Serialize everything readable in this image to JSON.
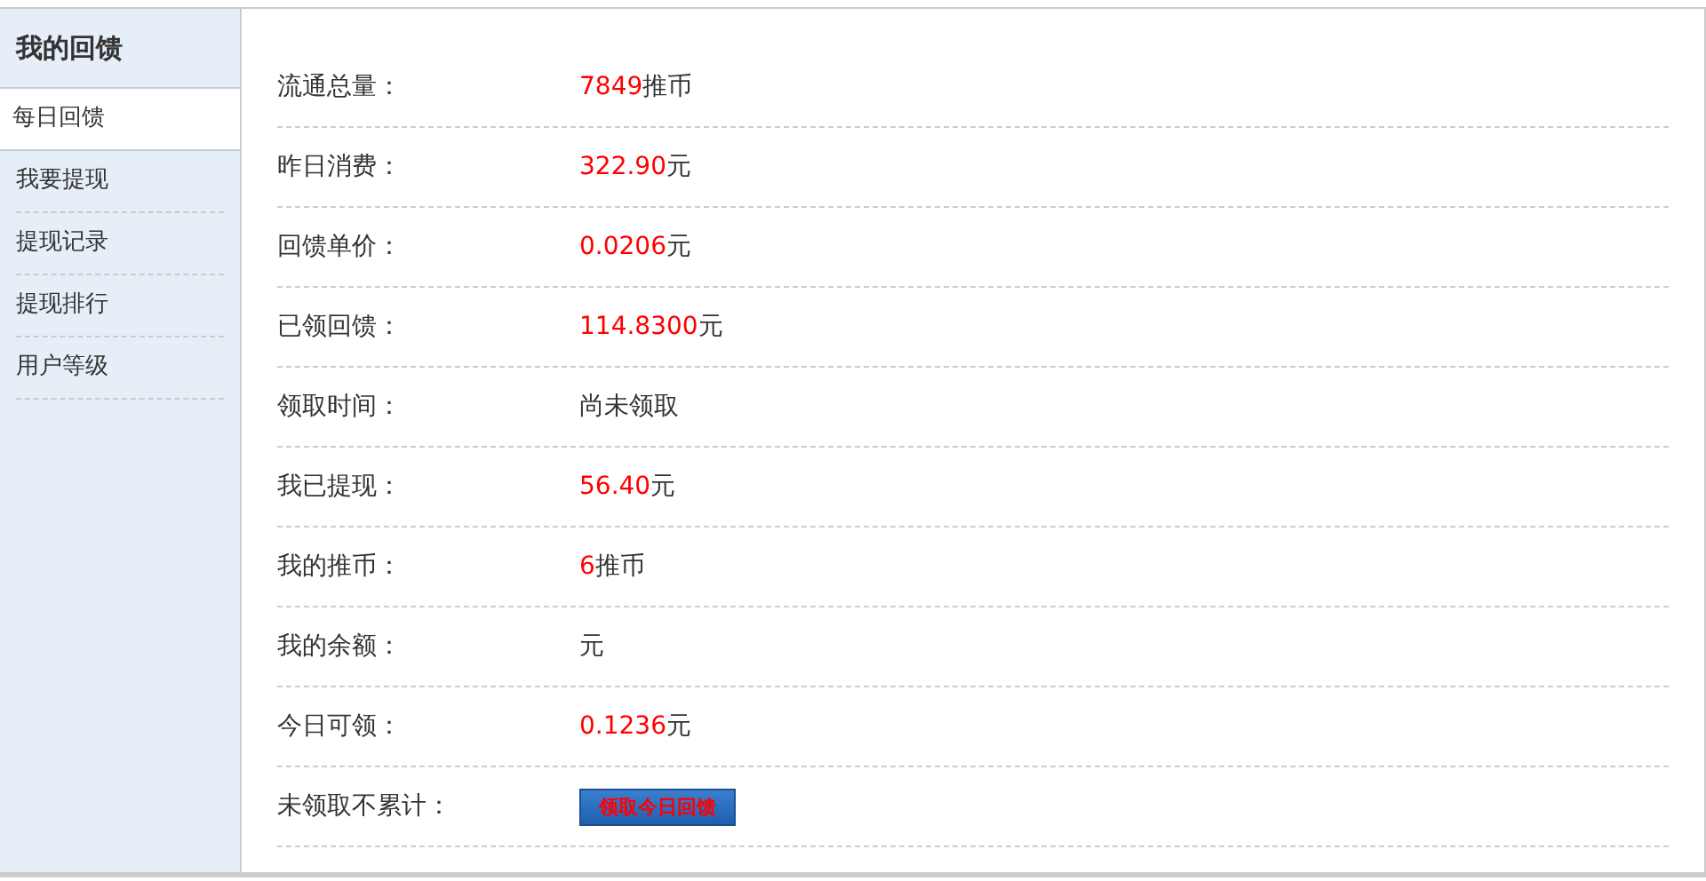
{
  "sidebar": {
    "title": "我的回馈",
    "items": [
      {
        "label": "每日回馈",
        "selected": true
      },
      {
        "label": "我要提现",
        "selected": false
      },
      {
        "label": "提现记录",
        "selected": false
      },
      {
        "label": "提现排行",
        "selected": false
      },
      {
        "label": "用户等级",
        "selected": false
      }
    ]
  },
  "rows": [
    {
      "label": "流通总量：",
      "value": "7849",
      "unit": "推币"
    },
    {
      "label": "昨日消费：",
      "value": "322.90",
      "unit": "元"
    },
    {
      "label": "回馈单价：",
      "value": "0.0206",
      "unit": "元"
    },
    {
      "label": "已领回馈：",
      "value": "114.8300",
      "unit": "元"
    },
    {
      "label": "领取时间：",
      "unit": "尚未领取"
    },
    {
      "label": "我已提现：",
      "value": "56.40",
      "unit": "元"
    },
    {
      "label": "我的推币：",
      "value": "6",
      "unit": "推币"
    },
    {
      "label": "我的余额：",
      "unit": "元"
    },
    {
      "label": "今日可领：",
      "value": "0.1236",
      "unit": "元"
    },
    {
      "label": "未领取不累计：",
      "button": "领取今日回馈"
    }
  ]
}
